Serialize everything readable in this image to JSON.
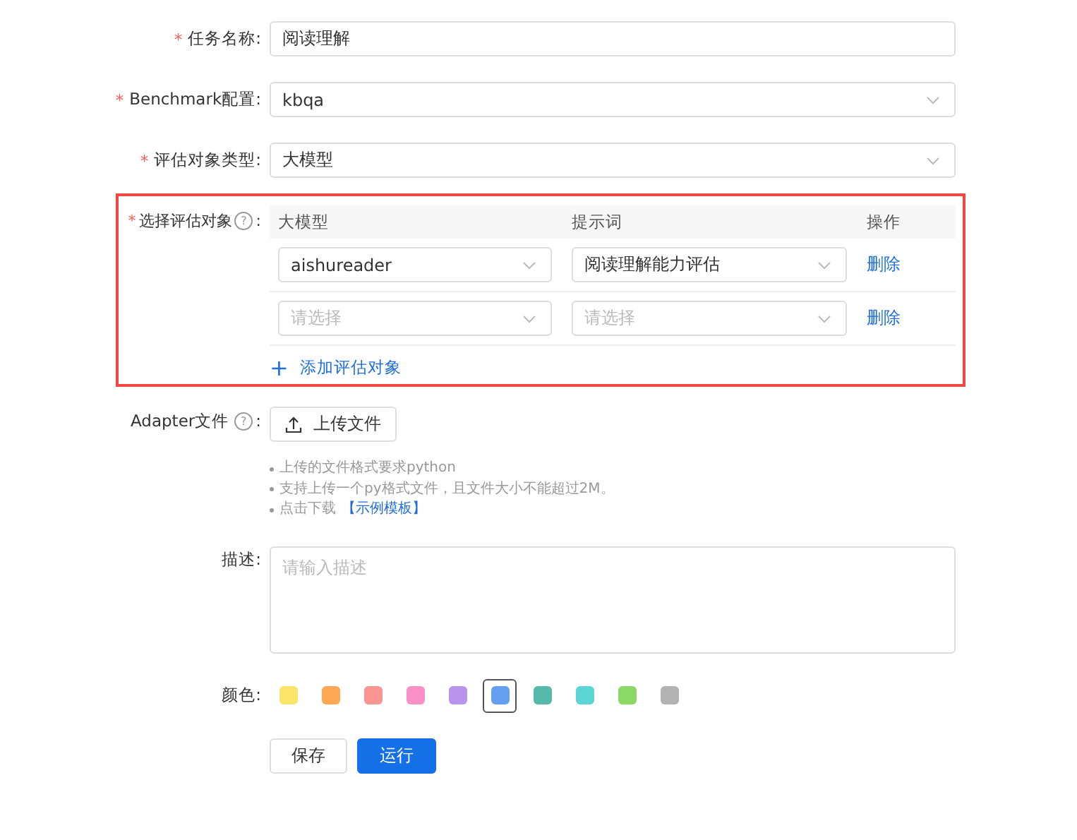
{
  "fields": [
    {
      "kind": "input",
      "asterisk": "*",
      "label": "任务名称:",
      "value": "阅读理解"
    },
    {
      "kind": "select",
      "asterisk": "*",
      "label": "Benchmark配置:",
      "value": "kbqa"
    },
    {
      "kind": "select",
      "asterisk": "*",
      "label": "评估对象类型:",
      "value": "大模型"
    }
  ],
  "targets": {
    "asterisk": "*",
    "label": "选择评估对象",
    "help": "?",
    "colon": ":",
    "highlighted": true,
    "columns": [
      "大模型",
      "提示词",
      "操作"
    ],
    "rows": [
      {
        "model": {
          "value": "aishureader"
        },
        "prompt": {
          "value": "阅读理解能力评估"
        },
        "action": "删除"
      },
      {
        "model": {
          "placeholder": "请选择"
        },
        "prompt": {
          "placeholder": "请选择"
        },
        "action": "删除"
      }
    ],
    "add": {
      "icon": "+",
      "label": "添加评估对象"
    }
  },
  "adapter": {
    "label": "Adapter文件",
    "help": "?",
    "colon": ":",
    "button": "上传文件",
    "notes": [
      {
        "text": "上传的文件格式要求python"
      },
      {
        "text": "支持上传一个py格式文件，且文件大小不能超过2M。"
      },
      {
        "text": "点击下载",
        "link": "【示例模板】"
      }
    ]
  },
  "description": {
    "label": "描述:",
    "placeholder": "请输入描述"
  },
  "colors": {
    "label": "颜色:",
    "swatches": [
      {
        "color": "#fce46a",
        "selected": false
      },
      {
        "color": "#fda854",
        "selected": false
      },
      {
        "color": "#f99691",
        "selected": false
      },
      {
        "color": "#fb8fc7",
        "selected": false
      },
      {
        "color": "#b994ed",
        "selected": false
      },
      {
        "color": "#65a0f0",
        "selected": true
      },
      {
        "color": "#57b9aa",
        "selected": false
      },
      {
        "color": "#5dd4d5",
        "selected": false
      },
      {
        "color": "#8bd867",
        "selected": false
      },
      {
        "color": "#b3b3b3",
        "selected": false
      }
    ]
  },
  "buttons": [
    {
      "kind": "default",
      "label": "保存"
    },
    {
      "kind": "primary",
      "label": "运行"
    }
  ]
}
